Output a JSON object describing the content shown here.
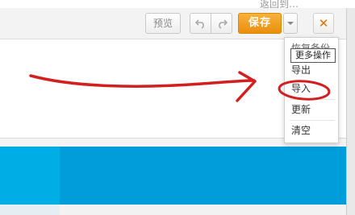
{
  "topbar": {
    "partial_text": "返回到…"
  },
  "toolbar": {
    "preview_label": "预览",
    "save_label": "保存",
    "close_label": "✕",
    "undo_icon": "undo-icon",
    "redo_icon": "redo-icon",
    "more_icon": "chevron-down-icon"
  },
  "dropdown": {
    "partial_top_item": "恢复备份",
    "items": [
      {
        "label": "导出"
      },
      {
        "label": "导入"
      },
      {
        "label": "更新"
      },
      {
        "label": "清空"
      }
    ]
  },
  "tooltip": {
    "text": "更多操作"
  },
  "annotation": {
    "color": "#d21f1f"
  },
  "colors": {
    "save": "#ee9a1c",
    "band": "#009ddb",
    "close": "#e07000"
  }
}
